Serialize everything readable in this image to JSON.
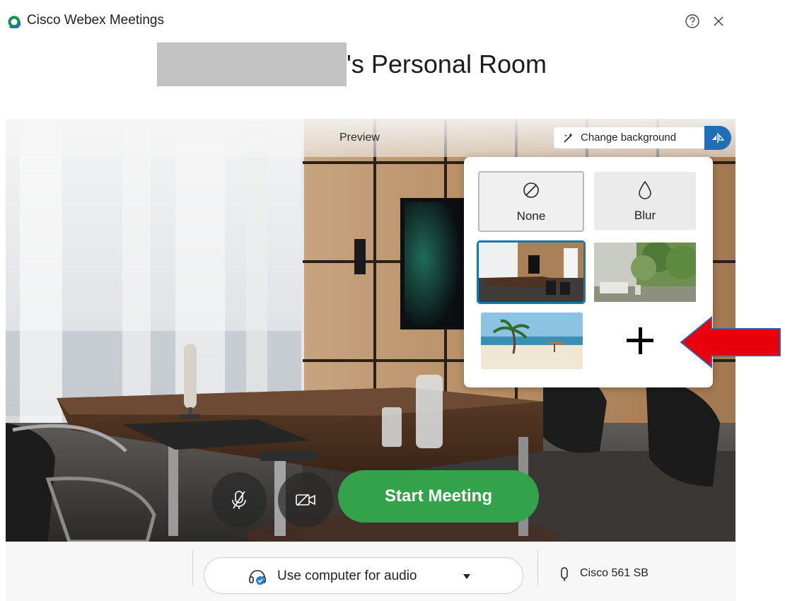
{
  "window": {
    "app_title": "Cisco Webex Meetings",
    "help_icon": "help-circle-icon",
    "close_icon": "close-icon"
  },
  "room": {
    "title_suffix": "'s Personal Room"
  },
  "preview": {
    "label": "Preview",
    "change_background_label": "Change background",
    "toggle_icon": "self-view-icon"
  },
  "background_panel": {
    "options": [
      {
        "label": "None",
        "icon": "no-symbol-icon",
        "selected": false
      },
      {
        "label": "Blur",
        "icon": "droplet-icon",
        "selected": false
      },
      {
        "label": "",
        "thumbnail": "office-interior",
        "selected": true
      },
      {
        "label": "",
        "thumbnail": "forest-living-room",
        "selected": false
      },
      {
        "label": "",
        "thumbnail": "tropical-beach",
        "selected": false
      },
      {
        "label": "",
        "icon": "plus-icon",
        "selected": false
      }
    ]
  },
  "controls": {
    "mute_icon": "microphone-muted-icon",
    "video_icon": "video-off-icon",
    "start_label": "Start Meeting"
  },
  "bottom_bar": {
    "audio_label": "Use computer for audio",
    "audio_icon": "headset-icon",
    "mic_device_label": "Cisco 561 SB",
    "mic_icon": "microphone-icon"
  },
  "colors": {
    "start_button": "#33a24a",
    "accent_blue": "#1f6fb5",
    "selection_border": "#177aa6",
    "annotation_arrow": "#e8000b"
  }
}
